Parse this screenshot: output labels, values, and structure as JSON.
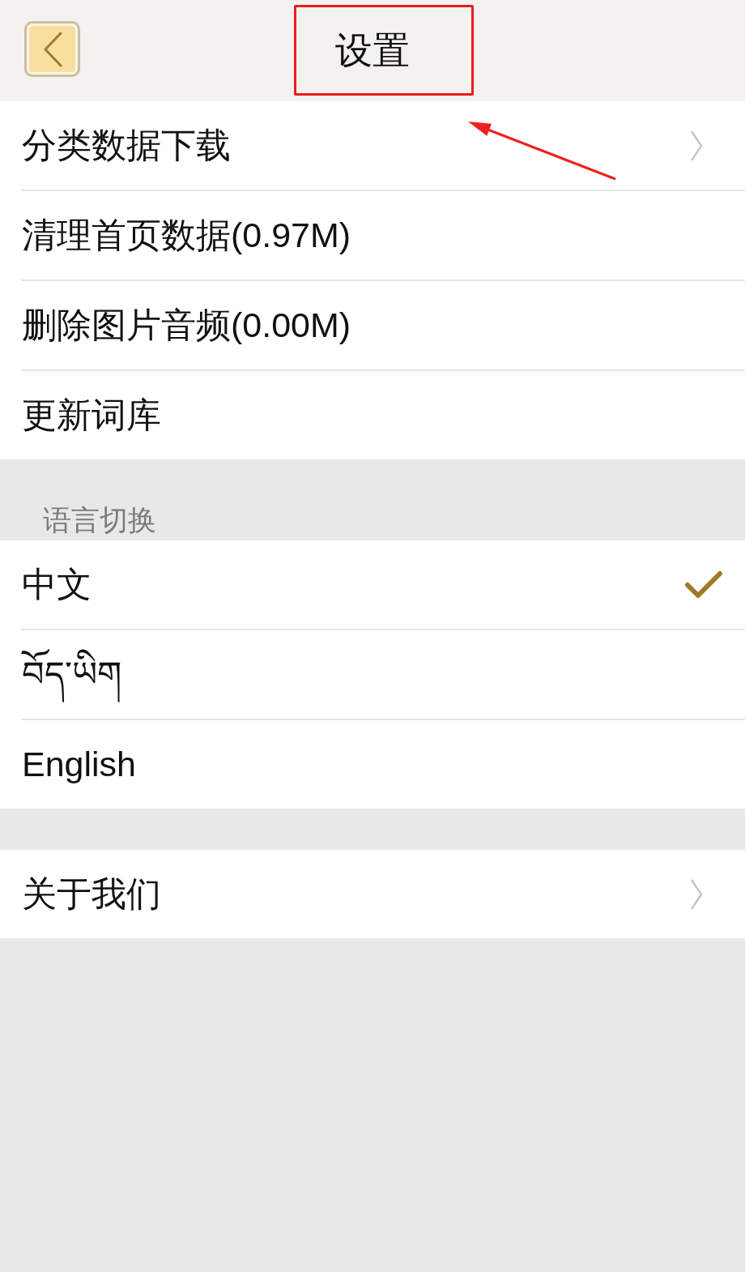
{
  "header": {
    "title": "设置"
  },
  "data_items": [
    {
      "label": "分类数据下载",
      "kind": "link"
    },
    {
      "label": "清理首页数据(0.97M)",
      "kind": "action"
    },
    {
      "label": "删除图片音频(0.00M)",
      "kind": "action"
    },
    {
      "label": "更新词库",
      "kind": "action"
    }
  ],
  "language": {
    "header": "语言切换",
    "options": [
      {
        "label": "中文",
        "selected": true
      },
      {
        "label": "བོད་ཡིག",
        "selected": false
      },
      {
        "label": "English",
        "selected": false
      }
    ]
  },
  "about_items": [
    {
      "label": "关于我们",
      "kind": "link"
    }
  ]
}
